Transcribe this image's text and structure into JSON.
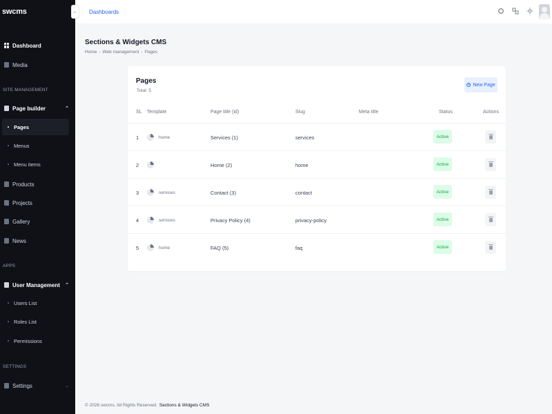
{
  "sidebar": {
    "logo": "swcms",
    "top_items": [
      {
        "label": "Dashboard"
      },
      {
        "label": "Media"
      }
    ],
    "site_management_label": "SITE MANAGEMENT",
    "page_builder": {
      "label": "Page builder",
      "children": [
        {
          "label": "Pages"
        },
        {
          "label": "Menus"
        },
        {
          "label": "Menu items"
        }
      ]
    },
    "site_items": [
      {
        "label": "Products"
      },
      {
        "label": "Projects"
      },
      {
        "label": "Gallery"
      },
      {
        "label": "News"
      }
    ],
    "apps_label": "APPS",
    "user_management": {
      "label": "User Management",
      "children": [
        {
          "label": "Users List"
        },
        {
          "label": "Roles List"
        },
        {
          "label": "Permissions"
        }
      ]
    },
    "settings_label": "SETTINGS",
    "settings_item": {
      "label": "Settings"
    }
  },
  "header": {
    "tab": "Dashboards",
    "collapse_icon": "←",
    "icons": [
      "search-icon",
      "translate-icon",
      "sun-icon"
    ]
  },
  "page": {
    "title": "Sections & Widgets CMS",
    "breadcrumb": [
      "Home",
      "Web management",
      "Pages"
    ]
  },
  "card": {
    "title": "Pages",
    "subtitle": "Total: 5",
    "new_button": "New Page",
    "columns": [
      "SL",
      "Template",
      "Page title (id)",
      "Slug",
      "Meta title",
      "Status",
      "Actions"
    ],
    "rows": [
      {
        "sl": "1",
        "template": "home",
        "title": "Services (1)",
        "slug": "services",
        "meta": "",
        "status": "Active"
      },
      {
        "sl": "2",
        "template": "",
        "title": "Home (2)",
        "slug": "home",
        "meta": "",
        "status": "Active"
      },
      {
        "sl": "3",
        "template": "services",
        "title": "Contact (3)",
        "slug": "contact",
        "meta": "",
        "status": "Active"
      },
      {
        "sl": "4",
        "template": "services",
        "title": "Privacy Policy (4)",
        "slug": "privacy-policy",
        "meta": "",
        "status": "Active"
      },
      {
        "sl": "5",
        "template": "home",
        "title": "FAQ (5)",
        "slug": "faq",
        "meta": "",
        "status": "Active"
      }
    ]
  },
  "footer": {
    "copyright": "© 2026 swcms. All Rights Reserved.",
    "brand": "Sections & Widgets CMS"
  },
  "colors": {
    "sidebar_bg": "#0f1117",
    "accent": "#2563eb",
    "active_badge_bg": "#dcfce7",
    "active_badge_text": "#16a34a"
  }
}
